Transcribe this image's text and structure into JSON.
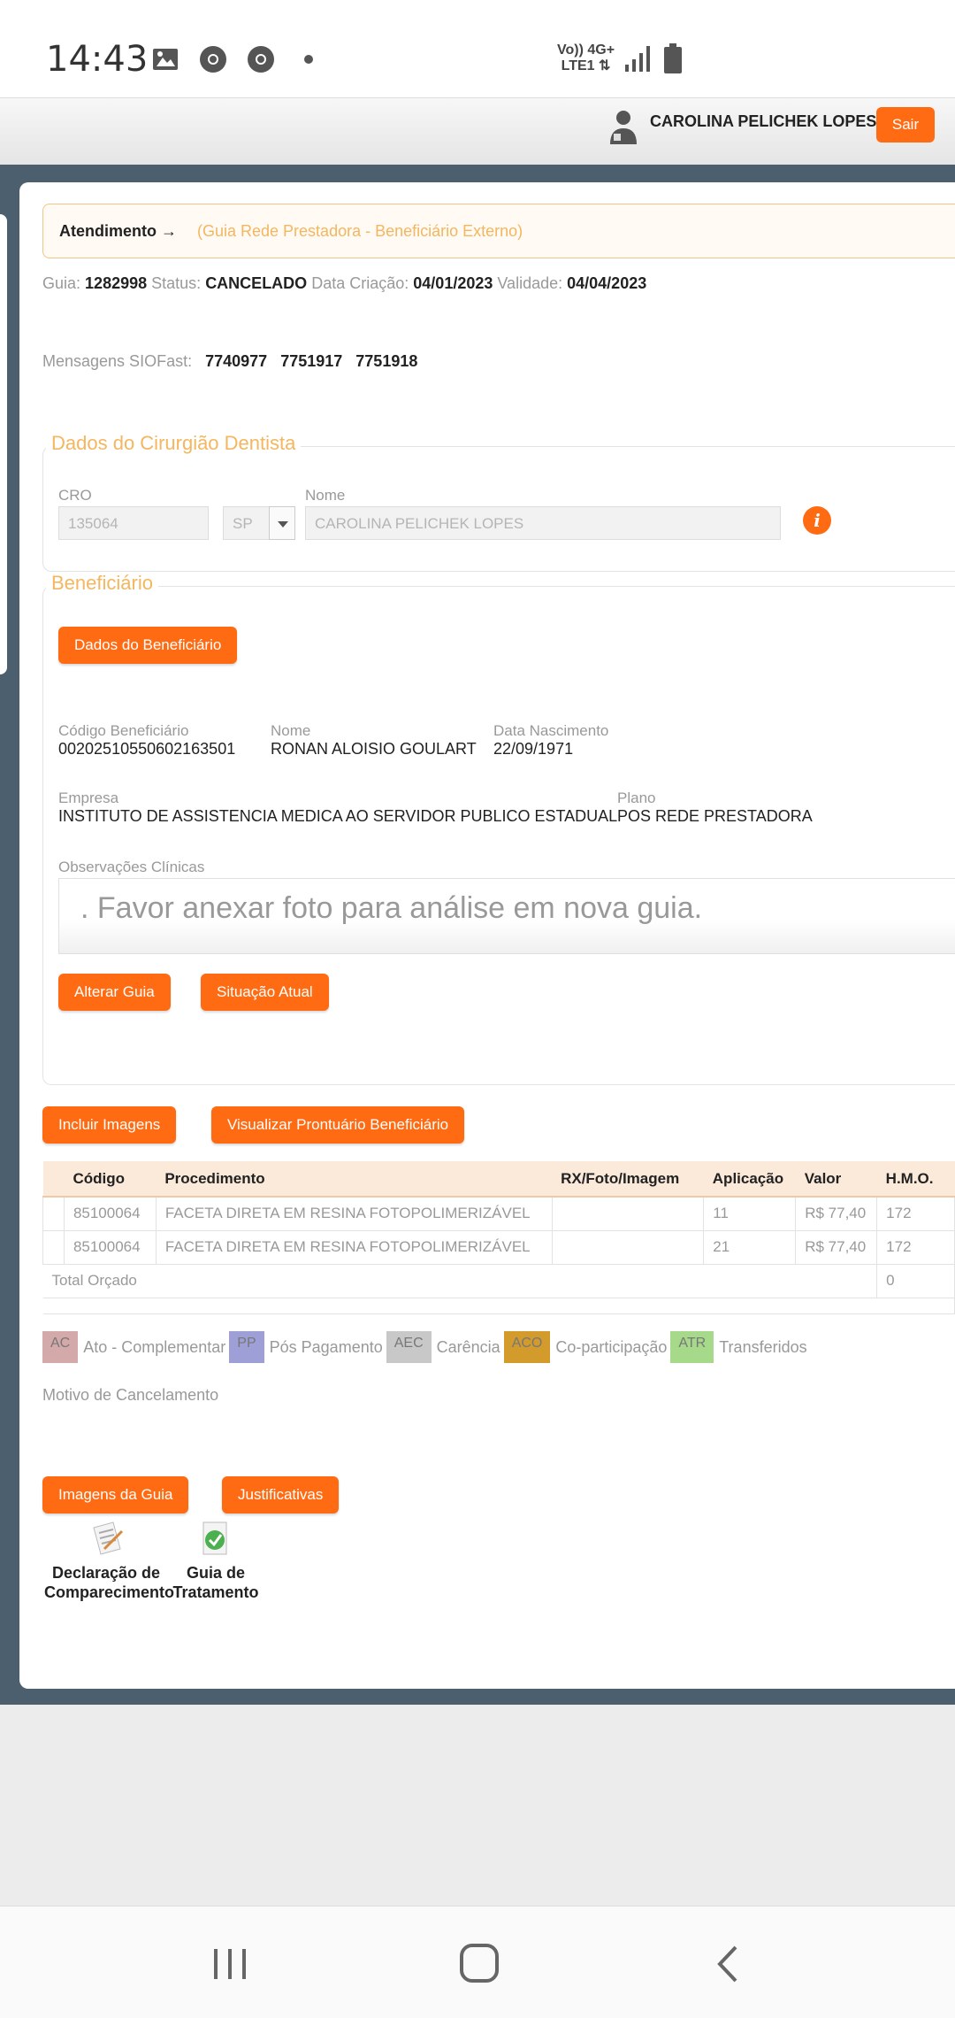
{
  "status_bar": {
    "time": "14:43",
    "network_top": "Vo))  4G+",
    "network_bottom": "LTE1 ⇅",
    "icons": [
      "gallery-icon",
      "chrome-icon",
      "chrome-icon",
      "dot-icon",
      "signal-icon",
      "battery-icon"
    ]
  },
  "header": {
    "user_name": "CAROLINA PELICHEK LOPES",
    "logout_label": "Sair"
  },
  "breadcrumb": {
    "main": "Atendimento →",
    "sub": "(Guia Rede Prestadora - Beneficiário Externo)"
  },
  "guide": {
    "guia_label": "Guia:",
    "guia_value": "1282998",
    "status_label": "Status:",
    "status_value": "CANCELADO",
    "created_label": "Data Criação:",
    "created_value": "04/01/2023",
    "validity_label": "Validade:",
    "validity_value": "04/04/2023"
  },
  "messages": {
    "label": "Mensagens SIOFast:",
    "values": [
      "7740977",
      "7751917",
      "7751918"
    ]
  },
  "dentist": {
    "legend": "Dados do Cirurgião Dentista",
    "cro_label": "CRO",
    "cro_value": "135064",
    "uf_value": "SP",
    "name_label": "Nome",
    "name_value": "CAROLINA PELICHEK LOPES",
    "info_glyph": "i"
  },
  "beneficiary": {
    "legend": "Beneficiário",
    "details_button": "Dados do Beneficiário",
    "code_label": "Código Beneficiário",
    "code_value": "00202510550602163501",
    "name_label": "Nome",
    "name_value": "RONAN ALOISIO GOULART",
    "birth_label": "Data Nascimento",
    "birth_value": "22/09/1971",
    "company_label": "Empresa",
    "company_value": "INSTITUTO DE ASSISTENCIA MEDICA AO SERVIDOR PUBLICO ESTADUAL",
    "plan_label": "Plano",
    "plan_value": "POS REDE PRESTADORA",
    "obs_label": "Observações Clínicas",
    "obs_value": ". Favor anexar foto para análise em nova guia.",
    "alter_button": "Alterar Guia",
    "status_button": "Situação Atual"
  },
  "actions": {
    "include_images": "Incluir Imagens",
    "view_record": "Visualizar Prontuário Beneficiário"
  },
  "table": {
    "headers": [
      "Código",
      "Procedimento",
      "RX/Foto/Imagem",
      "Aplicação",
      "Valor",
      "H.M.O."
    ],
    "rows": [
      {
        "code": "85100064",
        "procedure": "FACETA DIRETA EM RESINA FOTOPOLIMERIZÁVEL",
        "rx": "",
        "application": "11",
        "value": "R$ 77,40",
        "hmo": "172"
      },
      {
        "code": "85100064",
        "procedure": "FACETA DIRETA EM RESINA FOTOPOLIMERIZÁVEL",
        "rx": "",
        "application": "21",
        "value": "R$ 77,40",
        "hmo": "172"
      }
    ],
    "total_label": "Total Orçado",
    "total_hmo": "0"
  },
  "legend": [
    {
      "code": "AC",
      "text": "Ato - Complementar",
      "color": "#d4a9a9"
    },
    {
      "code": "PP",
      "text": "Pós Pagamento",
      "color": "#9e9fd6"
    },
    {
      "code": "AEC",
      "text": "Carência",
      "color": "#c8c8c8"
    },
    {
      "code": "ACO",
      "text": "Co-participação",
      "color": "#d39a2c"
    },
    {
      "code": "ATR",
      "text": "Transferidos",
      "color": "#a7d98a"
    }
  ],
  "cancel": {
    "label": "Motivo de Cancelamento"
  },
  "bottom_buttons": {
    "images": "Imagens da Guia",
    "justifications": "Justificativas"
  },
  "documents": {
    "declaration_line1": "Declaração de",
    "declaration_line2": "Comparecimento",
    "treatment_line1": "Guia de",
    "treatment_line2": "Tratamento"
  },
  "colors": {
    "accent": "#ff6b12",
    "legend_text": "#f4b65f",
    "frame": "#4c5f6e"
  }
}
